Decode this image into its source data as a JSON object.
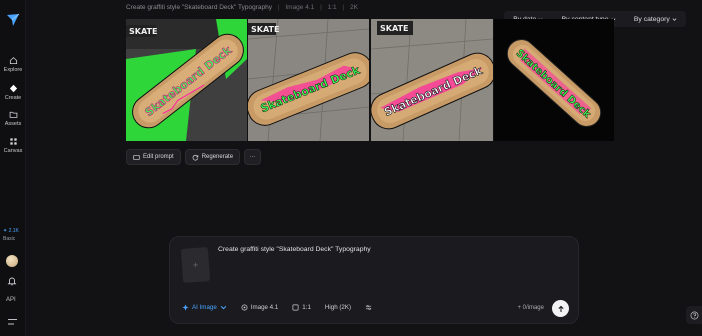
{
  "header": {
    "title": "Create graffiti style \"Skateboard Deck\" Typography",
    "model": "Image 4.1",
    "ratio": "1:1",
    "resolution": "2K"
  },
  "sidebar": {
    "items": [
      {
        "label": "Explore",
        "icon": "home-icon"
      },
      {
        "label": "Create",
        "icon": "diamond-icon"
      },
      {
        "label": "Assets",
        "icon": "folder-icon"
      },
      {
        "label": "Canvas",
        "icon": "grid-icon"
      }
    ],
    "credits": "2.1K",
    "plan": "Basic",
    "api_label": "API"
  },
  "filters": [
    {
      "label": "By date"
    },
    {
      "label": "By content type"
    },
    {
      "label": "By category"
    }
  ],
  "images": [
    {
      "deck_text": "Skateboard Deck",
      "stamp_text": "SKATE",
      "background": "green"
    },
    {
      "deck_text": "Skateboard Deck",
      "stamp_text": "SKATE",
      "background": "concrete"
    },
    {
      "deck_text": "Skateboard Deck",
      "stamp_text": "SKATE",
      "background": "concrete"
    },
    {
      "deck_text": "Skateboard Deck",
      "stamp_text": "",
      "background": "black"
    }
  ],
  "actions": {
    "edit_prompt": "Edit prompt",
    "regenerate": "Regenerate",
    "more": "···"
  },
  "composer": {
    "upload_symbol": "+",
    "prompt": "Create graffiti style \"Skateboard Deck\" Typography",
    "mode": "AI Image",
    "model": "Image 4.1",
    "ratio": "1:1",
    "quality": "High (2K)",
    "cost": "+ 0/image"
  },
  "colors": {
    "accent": "#4aa3ff",
    "background": "#121214",
    "panel": "#1b1b1f"
  }
}
